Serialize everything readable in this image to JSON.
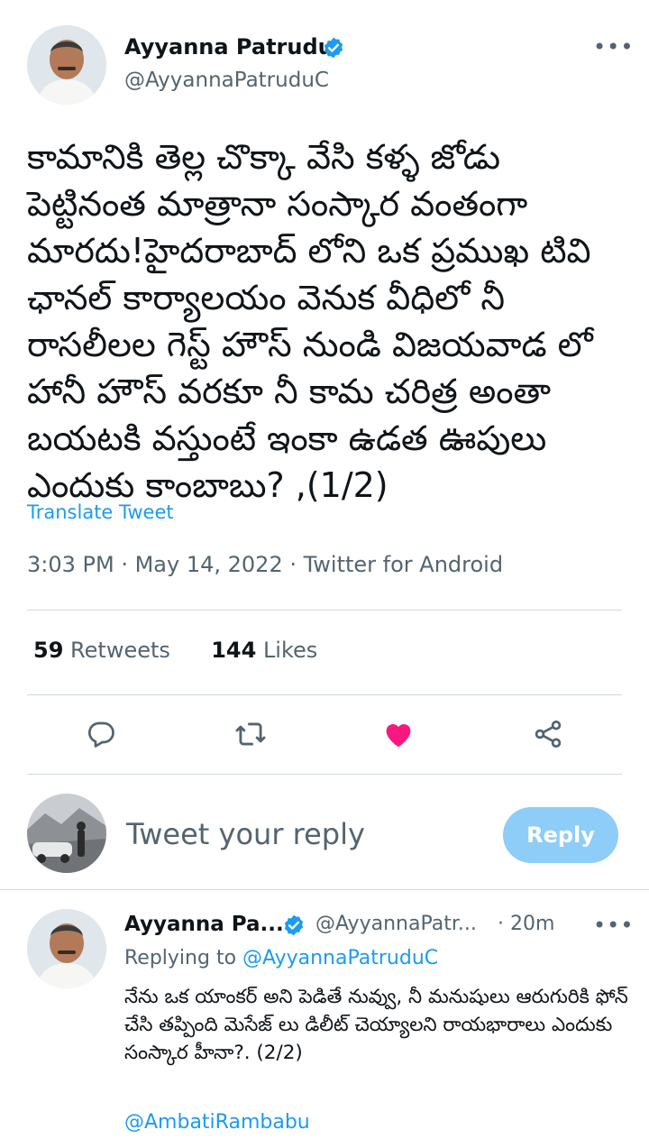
{
  "tweet": {
    "author_name": "Ayyanna Patrudu",
    "author_handle": "@AyyannaPatruduC",
    "more_icon": "•••",
    "text": "కామానికి తెల్ల చొక్కా వేసి కళ్ళ జోడు పెట్టినంత మాత్రానా సంస్కార వంతంగా మారదు!హైదరాబాద్ లోని ఒక ప్రముఖ టివి ఛానల్ కార్యాలయం వెనుక వీధిలో నీ రాసలీలల గెస్ట్ హౌస్ నుండి విజయవాడ లో హానీ హౌస్ వరకూ నీ కామ చరిత్ర అంతా బయటకి వస్తుంటే ఇంకా ఉడత ఊపులు ఎందుకు కాంబాబు? ,(1/2)",
    "translate_label": "Translate Tweet",
    "timestamp": "3:03 PM · May 14, 2022 · Twitter for Android",
    "retweets_count": "59",
    "retweets_label": "Retweets",
    "likes_count": "144",
    "likes_label": "Likes"
  },
  "actions": {
    "icons": [
      "reply-icon",
      "retweet-icon",
      "like-icon",
      "share-icon"
    ],
    "like_color": "#f91880"
  },
  "composer": {
    "placeholder": "Tweet your reply",
    "button_label": "Reply"
  },
  "reply": {
    "author_name": "Ayyanna Pa...",
    "author_handle": "@AyyannaPatr...",
    "time": "· 20m",
    "replying_prefix": "Replying to",
    "replying_to": "@AyyannaPatruduC",
    "text": "నేను ఒక యాంకర్ అని పెడితే నువ్వు, నీ మనుషులు ఆరుగురికి ఫోన్ చేసి తప్పింది మెసేజ్ లు డిలీట్ చెయ్యాలని రాయభారాలు ఎందుకు సంస్కార హీనా?. (2/2)",
    "mention": "@AmbatiRambabu"
  },
  "colors": {
    "accent": "#1d9bf0",
    "reply_button": "#8ecdf8",
    "secondary_text": "#536471"
  }
}
